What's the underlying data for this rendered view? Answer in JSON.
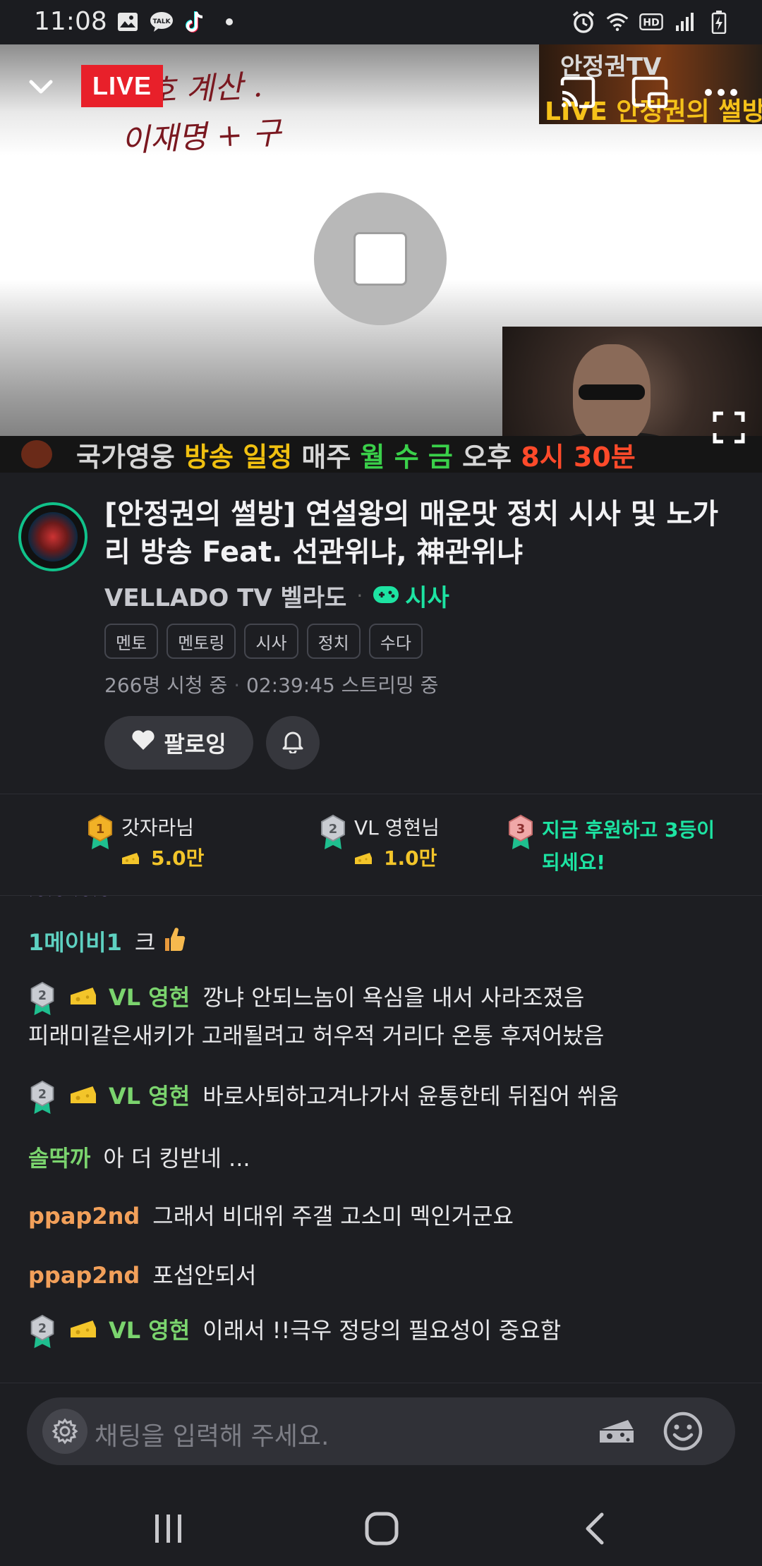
{
  "status_bar": {
    "time": "11:08",
    "icons_left": [
      "gallery-icon",
      "kakaotalk-icon",
      "tiktok-icon",
      "dot-icon"
    ],
    "icons_right": [
      "alarm-icon",
      "wifi-icon",
      "hd-icon",
      "signal-icon",
      "battery-icon"
    ]
  },
  "video": {
    "live_label": "LIVE",
    "handwriting_line1": "경호 계산 .",
    "handwriting_line2": "이재명 + 구",
    "overlay_channel": "안정권TV",
    "overlay_show": "LIVE 안정권의 썰방",
    "ticker": {
      "part1": "국가영웅",
      "part2": "방송 일정",
      "part3": "매주",
      "part4": "월 수 금",
      "part5": "오후",
      "part6": "8시 30분"
    }
  },
  "stream": {
    "title": "[안정권의 썰방] 연설왕의 매운맛 정치 시사 및 노가리 방송 Feat. 선관위냐, 神관위냐",
    "channel_name": "VELLADO TV 벨라도",
    "category": "시사",
    "tags": [
      "멘토",
      "멘토링",
      "시사",
      "정치",
      "수다"
    ],
    "viewers": "266명 시청 중",
    "duration": "02:39:45 스트리밍 중",
    "follow_label": "팔로잉"
  },
  "ranking": [
    {
      "rank": "1",
      "name": "갓자라님",
      "amount": "5.0만"
    },
    {
      "rank": "2",
      "name": "VL 영현님",
      "amount": "1.0만"
    },
    {
      "rank": "3",
      "cta_line1": "지금 후원하고 3등이",
      "cta_line2": "되세요!"
    }
  ],
  "chat": {
    "partial_line": "~~ ~~",
    "messages": [
      {
        "nick": "1메이비1",
        "text": "크"
      },
      {
        "nick": "VL 영현",
        "text_line1": "깡냐 안되느놈이 욕심을 내서 사라조졌음",
        "text_line2": "피래미같은새키가 고래될려고 허우적 거리다 온통  후져어놨음"
      },
      {
        "nick": "VL 영현",
        "text": "바로사퇴하고겨나가서 윤통한테 뒤집어 쒸움"
      },
      {
        "nick": "솔딱까",
        "text": "아 더 킹받네 ..."
      },
      {
        "nick": "ppap2nd",
        "text": "그래서 비대위 주갤 고소미 멕인거군요"
      },
      {
        "nick": "ppap2nd",
        "text": "포섭안되서"
      },
      {
        "nick": "VL 영현",
        "text": "이래서 !!극우 정당의 필요성이  중요함"
      }
    ]
  },
  "input": {
    "placeholder": "채팅을 입력해 주세요."
  },
  "colors": {
    "accent": "#1de3a2",
    "live_red": "#e8202a",
    "gold": "#f3c52a",
    "background": "#1d1e22"
  }
}
